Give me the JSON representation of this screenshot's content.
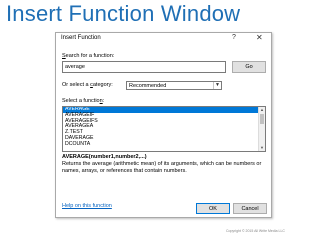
{
  "slide": {
    "title": "Insert Function Window"
  },
  "dialog": {
    "title": "Insert Function",
    "help_icon": "?",
    "close_icon": "✕",
    "search_label": "Search for a function:",
    "search_label_hotkey": "S",
    "search_label_rest": "earch for a function:",
    "search_value": "average",
    "go_label": "Go",
    "category_label_pre": "Or select a ",
    "category_label_hotkey": "c",
    "category_label_post": "ategory:",
    "category_value": "Recommended",
    "function_label_pre": "Select a functio",
    "function_label_hotkey": "n",
    "function_label_post": ":",
    "functions": [
      "AVERAGE",
      "AVERAGEIF",
      "AVERAGEIFS",
      "AVERAGEA",
      "Z.TEST",
      "DAVERAGE",
      "DCOUNTA"
    ],
    "selected_function": "AVERAGE",
    "syntax": "AVERAGE(number1,number2,...)",
    "description": "Returns the average (arithmetic mean) of its arguments, which can be numbers or names, arrays, or references that contain numbers.",
    "help_link": "Help on this function",
    "ok_label": "OK",
    "cancel_label": "Cancel"
  },
  "footer": {
    "copyright": "Copyright © 2015 All Write Media LLC"
  },
  "colors": {
    "title_blue": "#1f6fb5",
    "selection_blue": "#0078d7",
    "link_blue": "#0563c1"
  }
}
